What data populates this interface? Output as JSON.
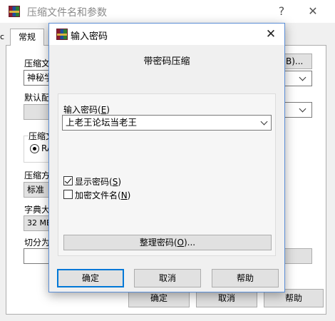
{
  "background_window": {
    "title": "压缩文件名和参数",
    "help_glyph": "?",
    "close_glyph": "✕",
    "tab_general": "常规",
    "left_edge_text": "c",
    "archive_name_label": "压缩文",
    "archive_name_value": "神秘学",
    "browse_label": "B)...",
    "default_profile_label": "默认配",
    "archive_format_label": "压缩文",
    "archive_format_option": "RA",
    "method_label": "压缩方",
    "method_value": "标准",
    "dictionary_label": "字典大",
    "dictionary_value": "32 MB",
    "split_label": "切分为",
    "ok_label": "确定",
    "cancel_label": "取消",
    "help_label": "帮助"
  },
  "dialog": {
    "title": "输入密码",
    "close_glyph": "✕",
    "header": "带密码压缩",
    "password_label_main": "输入密码(",
    "password_label_key": "E",
    "password_label_end": ")",
    "password_value": "上老王论坛当老王",
    "show_password_main": "显示密码(",
    "show_password_key": "S",
    "show_password_end": ")",
    "show_password_checked": true,
    "encrypt_names_main": "加密文件名(",
    "encrypt_names_key": "N",
    "encrypt_names_end": ")",
    "encrypt_names_checked": false,
    "organize_main": "整理密码(",
    "organize_key": "O",
    "organize_end": ")...",
    "ok_label": "确定",
    "cancel_label": "取消",
    "help_label": "帮助"
  },
  "colors": {
    "dialog_border": "#5b8ed6",
    "default_button_border": "#0078d7",
    "window_bg": "#f0f0f0"
  }
}
